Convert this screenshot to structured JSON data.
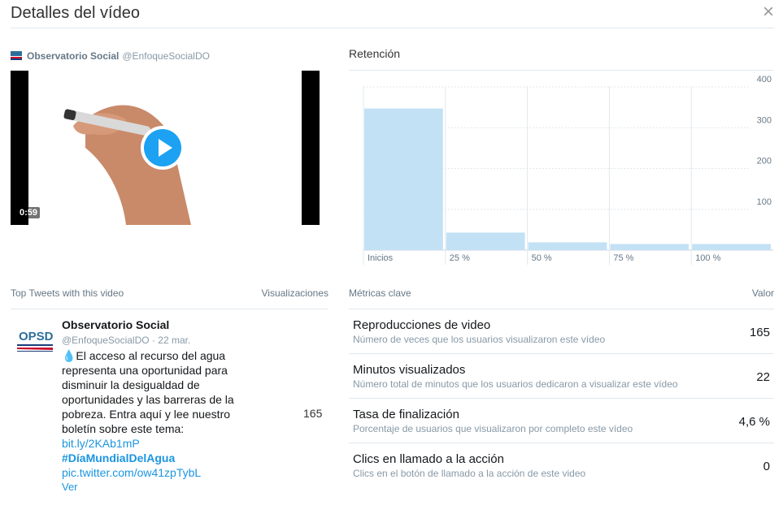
{
  "modal": {
    "title": "Detalles del vídeo",
    "close_label": "×"
  },
  "video": {
    "author_name": "Observatorio Social",
    "author_handle": "@EnfoqueSocialDO",
    "duration": "0:59"
  },
  "retention": {
    "title": "Retención",
    "chart_data": {
      "type": "bar",
      "categories": [
        "Inicios",
        "25 %",
        "50 %",
        "75 %",
        "100 %"
      ],
      "values": [
        347,
        43,
        19,
        15,
        15
      ],
      "ylim": [
        0,
        400
      ],
      "yticks": [
        100,
        200,
        300,
        400
      ],
      "y_axis_side": "right",
      "grid": true,
      "bar_color": "#c3e1f5"
    }
  },
  "top_tweets": {
    "header_label": "Top Tweets with this video",
    "views_header": "Visualizaciones",
    "tweets": [
      {
        "name": "Observatorio Social",
        "handle": "@EnfoqueSocialDO",
        "date": "22 mar.",
        "text": "💧El acceso al recurso del agua representa una oportunidad para disminuir la desigualdad de oportunidades y las barreras de la pobreza. Entra aquí y lee nuestro boletín sobre este tema: ",
        "link": "bit.ly/2KAb1mP",
        "hashtag": "#DíaMundialDelAgua",
        "pic": "pic.twitter.com/ow41zpTybL",
        "more": "Ver",
        "views": "165",
        "avatar_text": "OPSD"
      }
    ]
  },
  "metrics": {
    "header_label": "Métricas clave",
    "value_header": "Valor",
    "items": [
      {
        "name": "Reproducciones de video",
        "desc": "Número de veces que los usuarios visualizaron este vídeo",
        "value": "165"
      },
      {
        "name": "Minutos visualizados",
        "desc": "Número total de minutos que los usuarios dedicaron a visualizar este vídeo",
        "value": "22"
      },
      {
        "name": "Tasa de finalización",
        "desc": "Porcentaje de usuarios que visualizaron por completo este vídeo",
        "value": "4,6 %"
      },
      {
        "name": "Clics en llamado a la acción",
        "desc": "Clics en el botón de llamado a la acción de este video",
        "value": "0"
      }
    ]
  },
  "colors": {
    "accent": "#1da1f2",
    "link": "#1b95e0",
    "muted": "#8899a6"
  }
}
